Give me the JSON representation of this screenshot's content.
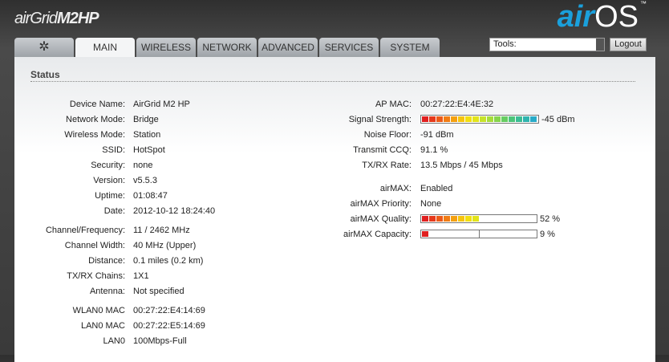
{
  "header": {
    "brand_a": "air",
    "brand_b": "Grid",
    "brand_c": "M2HP",
    "logo_air": "air",
    "logo_os": "OS",
    "logo_tm": "™"
  },
  "tabs": [
    {
      "label": "✲"
    },
    {
      "label": "MAIN"
    },
    {
      "label": "WIRELESS"
    },
    {
      "label": "NETWORK"
    },
    {
      "label": "ADVANCED"
    },
    {
      "label": "SERVICES"
    },
    {
      "label": "SYSTEM"
    }
  ],
  "tools": {
    "value": "Tools:",
    "logout": "Logout"
  },
  "section_title": "Status",
  "left": [
    {
      "label": "Device Name:",
      "value": "AirGrid M2 HP"
    },
    {
      "label": "Network Mode:",
      "value": "Bridge"
    },
    {
      "label": "Wireless Mode:",
      "value": "Station"
    },
    {
      "label": "SSID:",
      "value": "HotSpot"
    },
    {
      "label": "Security:",
      "value": "none"
    },
    {
      "label": "Version:",
      "value": "v5.5.3"
    },
    {
      "label": "Uptime:",
      "value": "01:08:47"
    },
    {
      "label": "Date:",
      "value": "2012-10-12 18:24:40"
    },
    {
      "label": "Channel/Frequency:",
      "value": "11 / 2462 MHz"
    },
    {
      "label": "Channel Width:",
      "value": "40 MHz (Upper)"
    },
    {
      "label": "Distance:",
      "value": "0.1 miles (0.2 km)"
    },
    {
      "label": "TX/RX Chains:",
      "value": "1X1"
    },
    {
      "label": "Antenna:",
      "value": "Not specified"
    },
    {
      "label": "WLAN0 MAC",
      "value": "00:27:22:E4:14:69"
    },
    {
      "label": "LAN0 MAC",
      "value": "00:27:22:E5:14:69"
    },
    {
      "label": "LAN0",
      "value": "100Mbps-Full"
    }
  ],
  "right": [
    {
      "label": "AP MAC:",
      "value": "00:27:22:E4:4E:32"
    },
    {
      "label": "Signal Strength:",
      "value": "-45 dBm",
      "bar_percent": 100
    },
    {
      "label": "Noise Floor:",
      "value": "-91 dBm"
    },
    {
      "label": "Transmit CCQ:",
      "value": "91.1 %"
    },
    {
      "label": "TX/RX Rate:",
      "value": "13.5 Mbps / 45 Mbps"
    },
    {
      "label": "airMAX:",
      "value": "Enabled"
    },
    {
      "label": "airMAX Priority:",
      "value": "None"
    },
    {
      "label": "airMAX Quality:",
      "value": "52 %",
      "bar_percent": 52
    },
    {
      "label": "airMAX Capacity:",
      "value": "9 %",
      "bar_percent": 9,
      "marker_percent": 50
    }
  ],
  "colors": {
    "segments": [
      "#e02020",
      "#e63a1c",
      "#ec5a18",
      "#f07c14",
      "#f4a010",
      "#f6c40e",
      "#f2de10",
      "#e2e41a",
      "#c6e22a",
      "#a6dc3a",
      "#86d44c",
      "#66cc62",
      "#4cc47a",
      "#3cbc94",
      "#30b4ae",
      "#28aac8"
    ]
  }
}
